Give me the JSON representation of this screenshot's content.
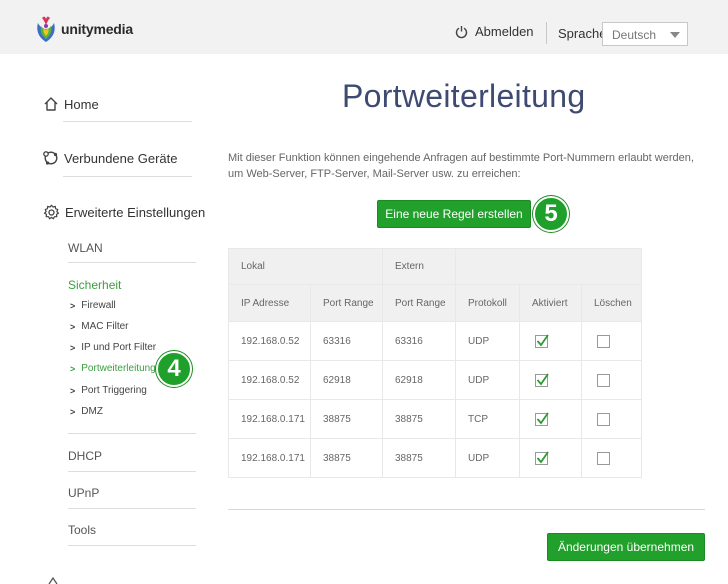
{
  "header": {
    "brand": "unitymedia",
    "logout_label": "Abmelden",
    "language_label": "Sprache",
    "language_value": "Deutsch"
  },
  "sidebar": {
    "main": [
      {
        "label": "Home",
        "icon": "home-icon"
      },
      {
        "label": "Verbundene Geräte",
        "icon": "devices-icon"
      },
      {
        "label": "Erweiterte Einstellungen",
        "icon": "gear-icon"
      }
    ],
    "sub": {
      "wlan": "WLAN",
      "sicherheit": "Sicherheit",
      "sicherheit_items": [
        "Firewall",
        "MAC Filter",
        "IP und Port Filter",
        "Portweiterleitung",
        "Port Triggering",
        "DMZ"
      ],
      "dhcp": "DHCP",
      "upnp": "UPnP",
      "tools": "Tools"
    }
  },
  "badges": {
    "sidebar": "4",
    "button": "5"
  },
  "main": {
    "title": "Portweiterleitung",
    "description": "Mit dieser Funktion können eingehende Anfragen auf bestimmte Port-Nummern erlaubt werden, um Web-Server, FTP-Server, Mail-Server usw. zu erreichen:",
    "new_rule_button": "Eine neue Regel erstellen",
    "apply_button": "Änderungen übernehmen"
  },
  "table": {
    "group_headers": [
      "Lokal",
      "Extern"
    ],
    "columns": [
      "IP Adresse",
      "Port Range",
      "Port Range",
      "Protokoll",
      "Aktiviert",
      "Löschen"
    ],
    "rows": [
      {
        "ip": "192.168.0.52",
        "local_port": "63316",
        "ext_port": "63316",
        "protocol": "UDP",
        "enabled": true,
        "delete": false
      },
      {
        "ip": "192.168.0.52",
        "local_port": "62918",
        "ext_port": "62918",
        "protocol": "UDP",
        "enabled": true,
        "delete": false
      },
      {
        "ip": "192.168.0.171",
        "local_port": "38875",
        "ext_port": "38875",
        "protocol": "TCP",
        "enabled": true,
        "delete": false
      },
      {
        "ip": "192.168.0.171",
        "local_port": "38875",
        "ext_port": "38875",
        "protocol": "UDP",
        "enabled": true,
        "delete": false
      }
    ]
  },
  "colors": {
    "accent_green": "#21a02c",
    "title_blue": "#3e4a72"
  }
}
